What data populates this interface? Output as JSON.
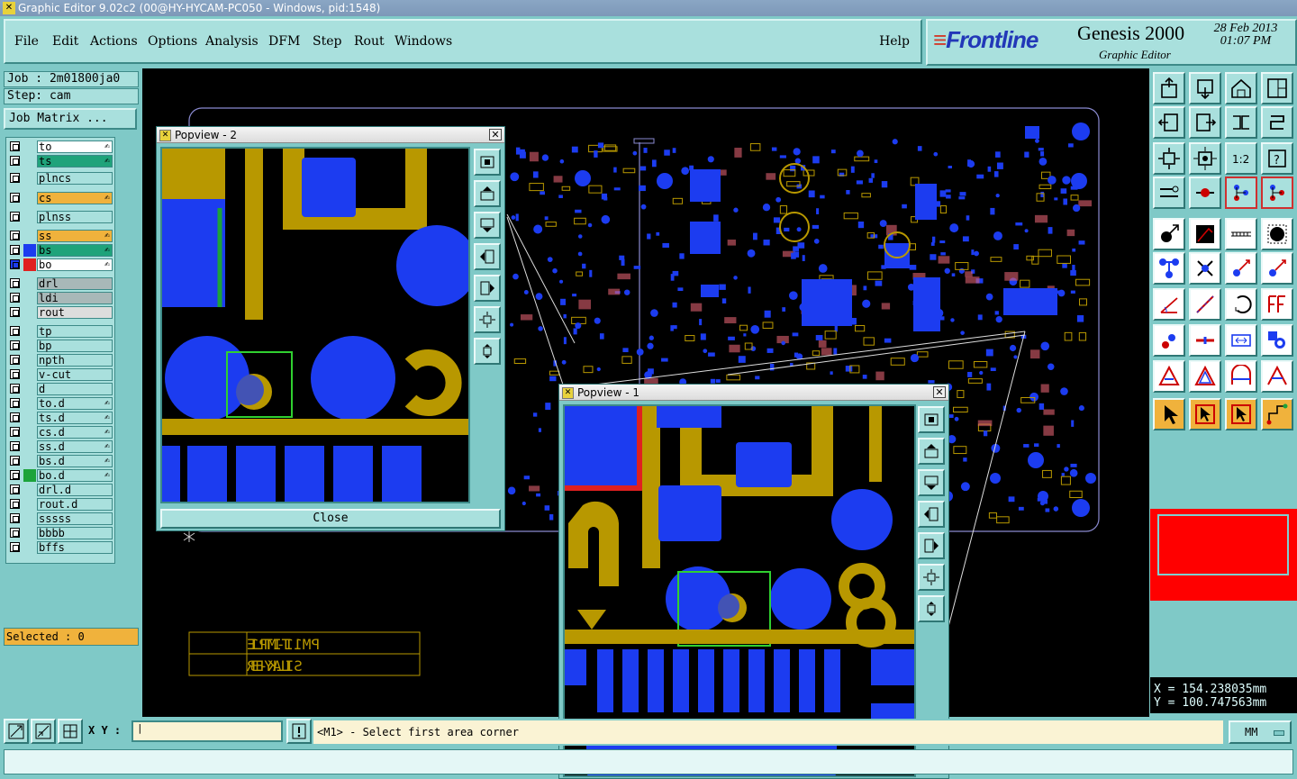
{
  "window_title": "Graphic Editor 9.02c2 (00@HY-HYCAM-PC050 - Windows, pid:1548)",
  "menu": [
    "File",
    "Edit",
    "Actions",
    "Options",
    "Analysis",
    "DFM",
    "Step",
    "Rout",
    "Windows"
  ],
  "help": "Help",
  "brand": {
    "logo": "Frontline",
    "product": "Genesis 2000",
    "subtitle": "Graphic Editor",
    "date": "28 Feb 2013",
    "time": "01:07 PM"
  },
  "job": "Job : 2m01800ja0",
  "step": "Step: cam",
  "job_matrix": "Job Matrix ...",
  "layers": [
    {
      "name": "to",
      "color": "#ffffff",
      "hand": true
    },
    {
      "name": "ts",
      "color": "#1fa37a",
      "hand": true
    },
    {
      "name": "plncs",
      "color": "#a9e0dd",
      "hand": false
    },
    {
      "name": "cs",
      "color": "#f0b23c",
      "hand": true
    },
    {
      "name": "plnss",
      "color": "#a9e0dd",
      "hand": false
    },
    {
      "name": "ss",
      "color": "#f0b23c",
      "hand": true
    },
    {
      "name": "bs",
      "color": "#1fa37a",
      "hand": true
    },
    {
      "name": "bo",
      "color": "#ffffff",
      "hand": true
    },
    {
      "name": "drl",
      "color": "#a8b8b8",
      "hand": false
    },
    {
      "name": "ldi",
      "color": "#a8b8b8",
      "hand": false
    },
    {
      "name": "rout",
      "color": "#dddddd",
      "hand": false
    },
    {
      "name": "tp",
      "color": "#a9e0dd",
      "hand": false
    },
    {
      "name": "bp",
      "color": "#a9e0dd",
      "hand": false
    },
    {
      "name": "npth",
      "color": "#a9e0dd",
      "hand": false
    },
    {
      "name": "v-cut",
      "color": "#a9e0dd",
      "hand": false
    },
    {
      "name": "d",
      "color": "#a9e0dd",
      "hand": false
    },
    {
      "name": "to.d",
      "color": "#a9e0dd",
      "hand": true
    },
    {
      "name": "ts.d",
      "color": "#a9e0dd",
      "hand": true
    },
    {
      "name": "cs.d",
      "color": "#a9e0dd",
      "hand": true
    },
    {
      "name": "ss.d",
      "color": "#a9e0dd",
      "hand": true
    },
    {
      "name": "bs.d",
      "color": "#a9e0dd",
      "hand": true
    },
    {
      "name": "bo.d",
      "color": "#a9e0dd",
      "hand": true
    },
    {
      "name": "drl.d",
      "color": "#a9e0dd",
      "hand": false
    },
    {
      "name": "rout.d",
      "color": "#a9e0dd",
      "hand": false
    },
    {
      "name": "sssss",
      "color": "#a9e0dd",
      "hand": false
    },
    {
      "name": "bbbb",
      "color": "#a9e0dd",
      "hand": false
    },
    {
      "name": "bffs",
      "color": "#a9e0dd",
      "hand": false
    }
  ],
  "selected": "Selected : 0",
  "popview2": {
    "title": "Popview - 2",
    "close": "Close"
  },
  "popview1": {
    "title": "Popview - 1"
  },
  "title_block": {
    "title_label": "TITLE",
    "title_value": "PM11-MP1",
    "layer_label": "LAYER",
    "layer_value": "SILK-B"
  },
  "coords": {
    "x": "X = 154.238035mm",
    "y": "Y = 100.747563mm"
  },
  "xy_label": "X Y :",
  "message": "<M1> - Select first area corner",
  "units": "MM",
  "colors": {
    "pad_blue": "#1c3cf0",
    "copper_gold": "#b89800",
    "panel_bg": "#7fc9c7",
    "highlight": "#f0b23c"
  }
}
